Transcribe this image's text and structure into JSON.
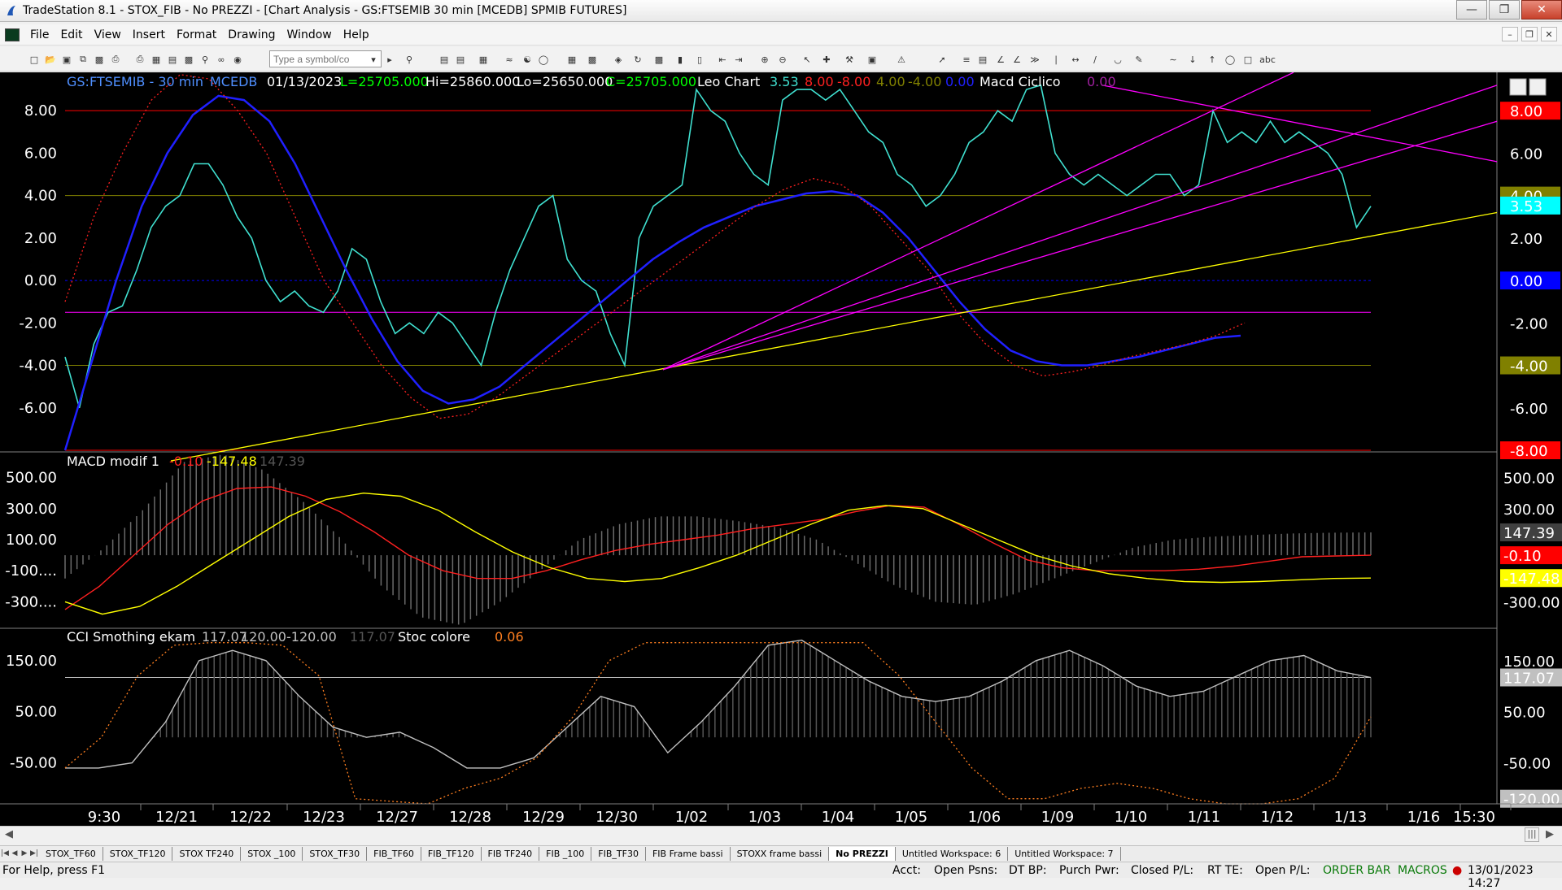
{
  "window": {
    "title": "TradeStation 8.1 - STOX_FIB - No PREZZI - [Chart Analysis - GS:FTSEMIB  30 min  [MCEDB] SPMIB FUTURES]"
  },
  "menu": [
    "File",
    "Edit",
    "View",
    "Insert",
    "Format",
    "Drawing",
    "Window",
    "Help"
  ],
  "toolbar": {
    "symbol_placeholder": "Type a symbol/co"
  },
  "chart_header": {
    "symbol": "GS:FTSEMIB - 30 min",
    "source": "MCEDB",
    "date": "01/13/2023",
    "last": "L=25705.000",
    "high": "Hi=25860.000",
    "low": "Lo=25650.000",
    "close": "C=25705.000",
    "indicator1": "Leo Chart",
    "v1": "3.53",
    "v2": "8.00",
    "v3": "-8.00",
    "v4": "4.00",
    "v5": "-4.00",
    "v6": "0.00",
    "indicator2": "Macd Ciclico",
    "v7": "0.00"
  },
  "panel2_header": {
    "name": "MACD modif 1",
    "v1": "-0.10",
    "v2": "-147.48",
    "v3": "147.39"
  },
  "panel3_header": {
    "name": "CCI Smothing ekam",
    "v1": "117.07",
    "v2": "120.00",
    "v3": "-120.00",
    "v4": "117.07",
    "name2": "Stoc colore",
    "v5": "0.06"
  },
  "panel1_axis": [
    "8.00",
    "6.00",
    "4.00",
    "2.00",
    "0.00",
    "-2.00",
    "-4.00",
    "-6.00"
  ],
  "panel1_right_badges": [
    {
      "text": "8.00",
      "bg": "#ff0000",
      "fg": "#000000",
      "v": 8
    },
    {
      "text": "6.00",
      "bg": "#000000",
      "fg": "#ffffff",
      "v": 6
    },
    {
      "text": "4.00",
      "bg": "#808000",
      "fg": "#000000",
      "v": 4
    },
    {
      "text": "3.53",
      "bg": "#00ffff",
      "fg": "#000000",
      "v": 3.53
    },
    {
      "text": "2.00",
      "bg": "#000000",
      "fg": "#ffffff",
      "v": 2
    },
    {
      "text": "0.00",
      "bg": "#0000ff",
      "fg": "#000000",
      "v": 0
    },
    {
      "text": "-2.00",
      "bg": "#000000",
      "fg": "#ffffff",
      "v": -2
    },
    {
      "text": "-4.00",
      "bg": "#808000",
      "fg": "#000000",
      "v": -4
    },
    {
      "text": "-6.00",
      "bg": "#000000",
      "fg": "#ffffff",
      "v": -6
    },
    {
      "text": "-8.00",
      "bg": "#ff0000",
      "fg": "#000000",
      "v": -8
    }
  ],
  "panel2_axis_left": [
    "500.00",
    "300.00",
    "100.00",
    "-100....",
    "-300...."
  ],
  "panel2_right_badges": [
    {
      "text": "500.00",
      "bg": "#000000",
      "fg": "#ffffff",
      "v": 500
    },
    {
      "text": "300.00",
      "bg": "#000000",
      "fg": "#ffffff",
      "v": 300
    },
    {
      "text": "147.39",
      "bg": "#404040",
      "fg": "#c0c0c0",
      "v": 147.39
    },
    {
      "text": "-0.10",
      "bg": "#ff0000",
      "fg": "#000000",
      "v": -0.1
    },
    {
      "text": "-147.48",
      "bg": "#ffff00",
      "fg": "#000000",
      "v": -147.48
    },
    {
      "text": "-300.00",
      "bg": "#000000",
      "fg": "#ffffff",
      "v": -300
    }
  ],
  "panel3_axis_left": [
    "150.00",
    "50.00",
    "-50.00"
  ],
  "panel3_right_badges": [
    {
      "text": "150.00",
      "bg": "#000000",
      "fg": "#ffffff",
      "v": 150
    },
    {
      "text": "117.07",
      "bg": "#c0c0c0",
      "fg": "#000000",
      "v": 117.07
    },
    {
      "text": "50.00",
      "bg": "#000000",
      "fg": "#ffffff",
      "v": 50
    },
    {
      "text": "-50.00",
      "bg": "#000000",
      "fg": "#ffffff",
      "v": -50
    },
    {
      "text": "-120.00",
      "bg": "#c0c0c0",
      "fg": "#000000",
      "v": -120
    }
  ],
  "x_labels": [
    "9:30",
    "12/21",
    "12/22",
    "12/23",
    "12/27",
    "12/28",
    "12/29",
    "12/30",
    "1/02",
    "1/03",
    "1/04",
    "1/05",
    "1/06",
    "1/09",
    "1/10",
    "1/11",
    "1/12",
    "1/13",
    "1/16",
    "15:30"
  ],
  "tabs": [
    "STOX_TF60",
    "STOX_TF120",
    "STOX TF240",
    "STOX _100",
    "STOX_TF30",
    "FIB_TF60",
    "FIB_TF120",
    "FIB TF240",
    "FIB _100",
    "FIB_TF30",
    "FIB Frame bassi",
    "STOXX frame bassi",
    "No PREZZI",
    "Untitled Workspace:  6",
    "Untitled Workspace:  7"
  ],
  "active_tab": "No PREZZI",
  "status": {
    "help": "For Help, press F1",
    "acct": "Acct:",
    "open_psns": "Open Psns:",
    "dt_bp": "DT BP:",
    "purch_pwr": "Purch Pwr:",
    "closed_pl": "Closed P/L:",
    "rt_te": "RT TE:",
    "open_pl": "Open P/L:",
    "order_bar": "ORDER BAR",
    "macros": "MACROS",
    "datetime": "13/01/2023 14:27"
  },
  "colors": {
    "price_line": "#40e0d0",
    "blue_cycle": "#2020ff",
    "red_dotted": "#ff2020",
    "magenta": "#ff00ff",
    "yellow": "#ffff00",
    "panel_bg": "#000000"
  },
  "chart_data": [
    {
      "type": "line",
      "title": "Leo Chart / Macd Ciclico",
      "ylim": [
        -8,
        9.5
      ],
      "x": [
        0,
        2,
        4,
        6,
        8,
        10,
        12,
        14,
        16,
        18,
        20,
        22,
        24,
        26,
        28,
        30,
        32,
        34,
        36,
        38,
        40,
        42,
        44,
        46,
        48,
        50,
        52,
        54,
        56,
        58,
        60,
        62,
        64,
        66,
        68,
        70,
        72,
        74,
        76,
        78,
        80,
        82,
        84,
        86,
        88,
        90,
        92,
        94,
        96,
        98,
        100,
        102,
        104,
        106,
        108,
        110,
        112,
        114,
        116,
        118,
        120,
        122,
        124,
        126,
        128,
        130,
        132,
        134,
        136,
        138,
        140,
        142,
        144,
        146,
        148,
        150,
        152,
        154,
        156,
        158,
        160,
        162,
        164,
        166,
        168,
        170,
        172,
        174,
        176,
        178,
        180,
        182,
        184,
        186,
        188,
        190,
        192,
        194,
        196,
        198,
        200
      ],
      "series": [
        {
          "name": "price",
          "values": [
            -3.6,
            -6.0,
            -3.0,
            -1.5,
            -1.2,
            0.5,
            2.5,
            3.5,
            4.0,
            5.5,
            5.5,
            4.5,
            3.0,
            2.0,
            0.0,
            -1.0,
            -0.5,
            -1.2,
            -1.5,
            -0.5,
            1.5,
            1.0,
            -1.0,
            -2.5,
            -2.0,
            -2.5,
            -1.5,
            -2.0,
            -3.0,
            -4.0,
            -1.5,
            0.5,
            2.0,
            3.5,
            4.0,
            1.0,
            0.0,
            -0.5,
            -2.5,
            -4.0,
            2.0,
            3.5,
            4.0,
            4.5,
            9.0,
            8.0,
            7.5,
            6.0,
            5.0,
            4.5,
            8.5,
            9.0,
            9.0,
            8.5,
            9.0,
            8.0,
            7.0,
            6.5,
            5.0,
            4.5,
            3.5,
            4.0,
            5.0,
            6.5,
            7.0,
            8.0,
            7.5,
            9.0,
            9.2,
            6.0,
            5.0,
            4.5,
            5.0,
            4.5,
            4.0,
            4.5,
            5.0,
            5.0,
            4.0,
            4.5,
            8.0,
            6.5,
            7.0,
            6.5,
            7.5,
            6.5,
            7.0,
            6.5,
            6.0,
            5.0,
            2.5,
            3.5,
            null,
            null,
            null,
            null,
            null,
            null,
            null,
            null,
            null
          ]
        },
        {
          "name": "blue cycle",
          "values": [
            -8.0,
            -4.0,
            0.0,
            3.5,
            6.0,
            7.8,
            8.7,
            8.5,
            7.5,
            5.5,
            3.0,
            0.5,
            -1.8,
            -3.8,
            -5.2,
            -5.8,
            -5.6,
            -5.0,
            -4.0,
            -3.0,
            -2.0,
            -1.0,
            0.0,
            1.0,
            1.8,
            2.5,
            3.0,
            3.5,
            3.8,
            4.1,
            4.2,
            4.0,
            3.2,
            2.0,
            0.5,
            -1.0,
            -2.3,
            -3.3,
            -3.8,
            -4.0,
            -4.0,
            -3.8,
            -3.6,
            -3.3,
            -3.0,
            -2.7,
            -2.6,
            null,
            null,
            null,
            null,
            null,
            null,
            null,
            null,
            null,
            null,
            null,
            null,
            null,
            null,
            null,
            null,
            null,
            null,
            null,
            null,
            null,
            null,
            null,
            null,
            null,
            null,
            null,
            null,
            null,
            null,
            null,
            null,
            null,
            null,
            null,
            null,
            null,
            null,
            null,
            null,
            null,
            null,
            null,
            null,
            null,
            null,
            null,
            null,
            null,
            null,
            null,
            null,
            null,
            null
          ]
        }
      ]
    },
    {
      "type": "line",
      "title": "MACD modif 1",
      "ylim": [
        -450,
        650
      ],
      "series": [
        {
          "name": "red",
          "values": [
            -350,
            -200,
            0,
            200,
            350,
            430,
            440,
            380,
            280,
            150,
            0,
            -100,
            -150,
            -150,
            -100,
            -30,
            30,
            70,
            100,
            130,
            170,
            200,
            230,
            280,
            320,
            310,
            200,
            80,
            -30,
            -80,
            -100,
            -100,
            -100,
            -90,
            -70,
            -40,
            -10,
            -5,
            0
          ]
        },
        {
          "name": "yellow",
          "values": [
            -300,
            -380,
            -330,
            -200,
            -50,
            100,
            250,
            360,
            400,
            380,
            290,
            150,
            20,
            -80,
            -150,
            -170,
            -150,
            -80,
            0,
            100,
            200,
            290,
            320,
            300,
            200,
            100,
            0,
            -70,
            -120,
            -150,
            -170,
            -175,
            -170,
            -160,
            -150,
            -147
          ]
        },
        {
          "name": "histogram",
          "values": [
            -150,
            50,
            300,
            600,
            650,
            550,
            350,
            100,
            -200,
            -400,
            -450,
            -300,
            -100,
            100,
            200,
            250,
            250,
            220,
            180,
            100,
            -50,
            -200,
            -300,
            -320,
            -250,
            -150,
            -50,
            50,
            100,
            120,
            130,
            140,
            145,
            147
          ]
        }
      ]
    },
    {
      "type": "line",
      "title": "CCI Smothing ekam / Stoc colore",
      "ylim": [
        -130,
        210
      ],
      "series": [
        {
          "name": "cci",
          "values": [
            -60,
            -60,
            -50,
            30,
            150,
            170,
            150,
            80,
            20,
            0,
            10,
            -20,
            -60,
            -60,
            -40,
            20,
            80,
            60,
            -30,
            30,
            100,
            180,
            190,
            150,
            110,
            80,
            70,
            80,
            110,
            150,
            170,
            140,
            100,
            80,
            90,
            120,
            150,
            160,
            130,
            117
          ]
        },
        {
          "name": "stoc",
          "values": [
            -60,
            0,
            120,
            180,
            185,
            185,
            180,
            120,
            -120,
            -125,
            -130,
            -100,
            -80,
            -40,
            40,
            150,
            185,
            185,
            185,
            185,
            185,
            185,
            185,
            120,
            30,
            -60,
            -120,
            -120,
            -100,
            -90,
            -100,
            -120,
            -130,
            -130,
            -120,
            -80,
            40
          ]
        }
      ]
    }
  ]
}
